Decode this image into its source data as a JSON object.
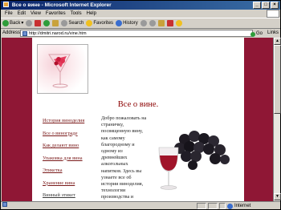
{
  "window": {
    "title": "Все о вине - Microsoft Internet Explorer"
  },
  "menubar": {
    "items": [
      "File",
      "Edit",
      "View",
      "Favorites",
      "Tools",
      "Help"
    ]
  },
  "toolbar": {
    "back_label": "Back",
    "search_label": "Search",
    "favorites_label": "Favorites",
    "history_label": "History"
  },
  "addressbar": {
    "label": "Address",
    "url": "http://dmitri.narod.ru/vine.htm",
    "go_label": "Go",
    "links_label": "Links"
  },
  "page": {
    "heading": "Все о вине.",
    "nav_items": [
      "История виноделия",
      "Все о винограде",
      "Как делают вино",
      "Упаковка для вина",
      "Этикетка",
      "Хранение вина",
      "Винный этикет"
    ],
    "article_text": "Добро пожаловать на страничку, посвященную вину, как самому благородному и одному из древнейших алкогольных напитков. Здесь вы узнаете все об истории виноделия, технологии производства и хранения вин, о том, как сделать достойное вино в"
  },
  "statusbar": {
    "left_text": "",
    "zone_label": "Internet"
  }
}
